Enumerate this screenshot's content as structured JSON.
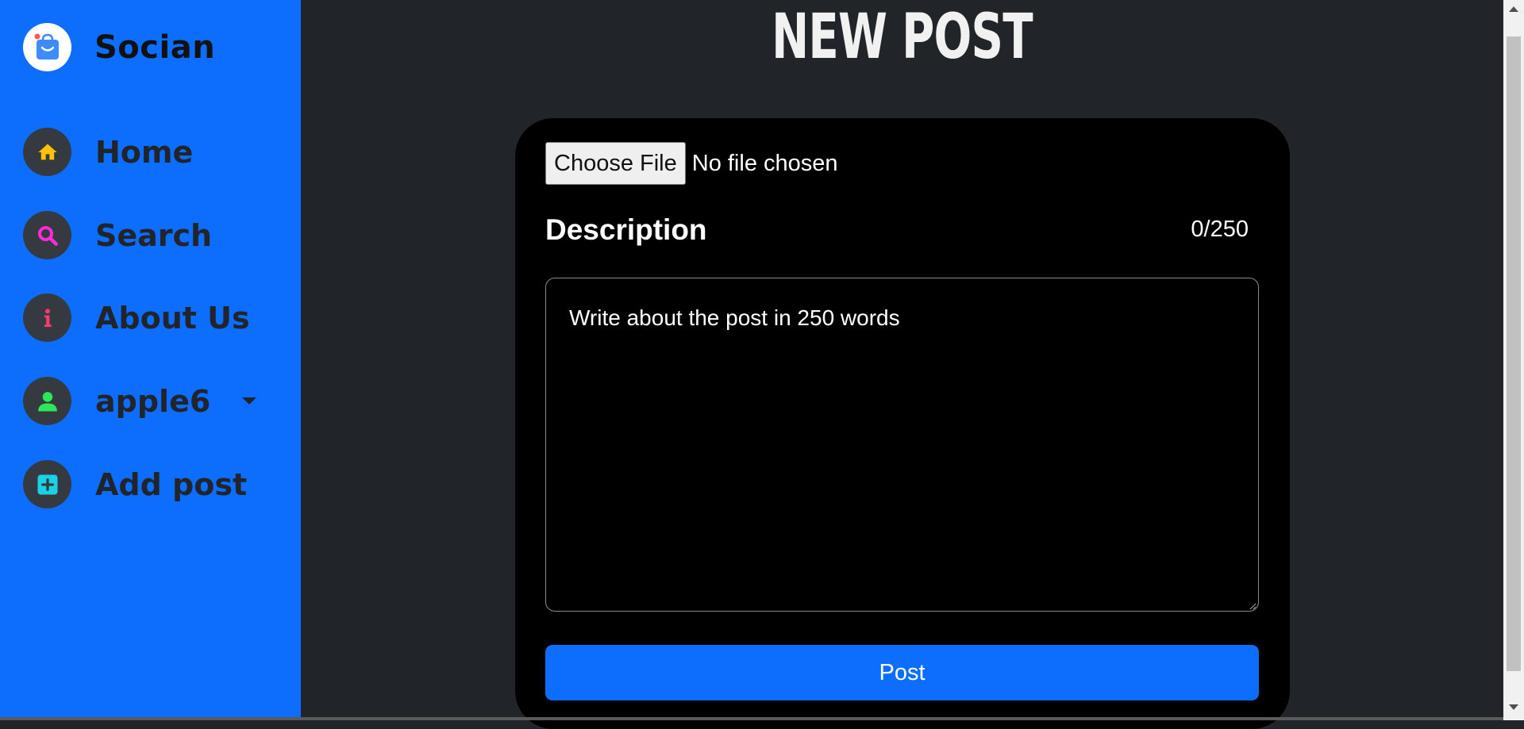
{
  "brand": {
    "name": "Socian",
    "logo_icon": "shopping-bag-smile-icon"
  },
  "sidebar": {
    "items": [
      {
        "label": "Home",
        "icon": "home-icon",
        "icon_color": "#ffc107"
      },
      {
        "label": "Search",
        "icon": "search-icon",
        "icon_color": "#ff2bd6"
      },
      {
        "label": "About Us",
        "icon": "info-icon",
        "icon_color": "#ff3b6b"
      },
      {
        "label": "apple6",
        "icon": "user-icon",
        "icon_color": "#2ee65a",
        "has_dropdown": true
      },
      {
        "label": "Add post",
        "icon": "plus-square-icon",
        "icon_color": "#1ad1e6"
      }
    ]
  },
  "page": {
    "title": "NEW POST"
  },
  "form": {
    "file_button_label": "Choose File",
    "file_status": "No file chosen",
    "description_label": "Description",
    "counter": "0/250",
    "textarea_placeholder": "Write about the post in 250 words",
    "textarea_value": "",
    "submit_label": "Post"
  },
  "colors": {
    "sidebar_bg": "#0d6efd",
    "page_bg": "#212529",
    "card_bg": "#000000",
    "accent": "#0d6efd"
  }
}
